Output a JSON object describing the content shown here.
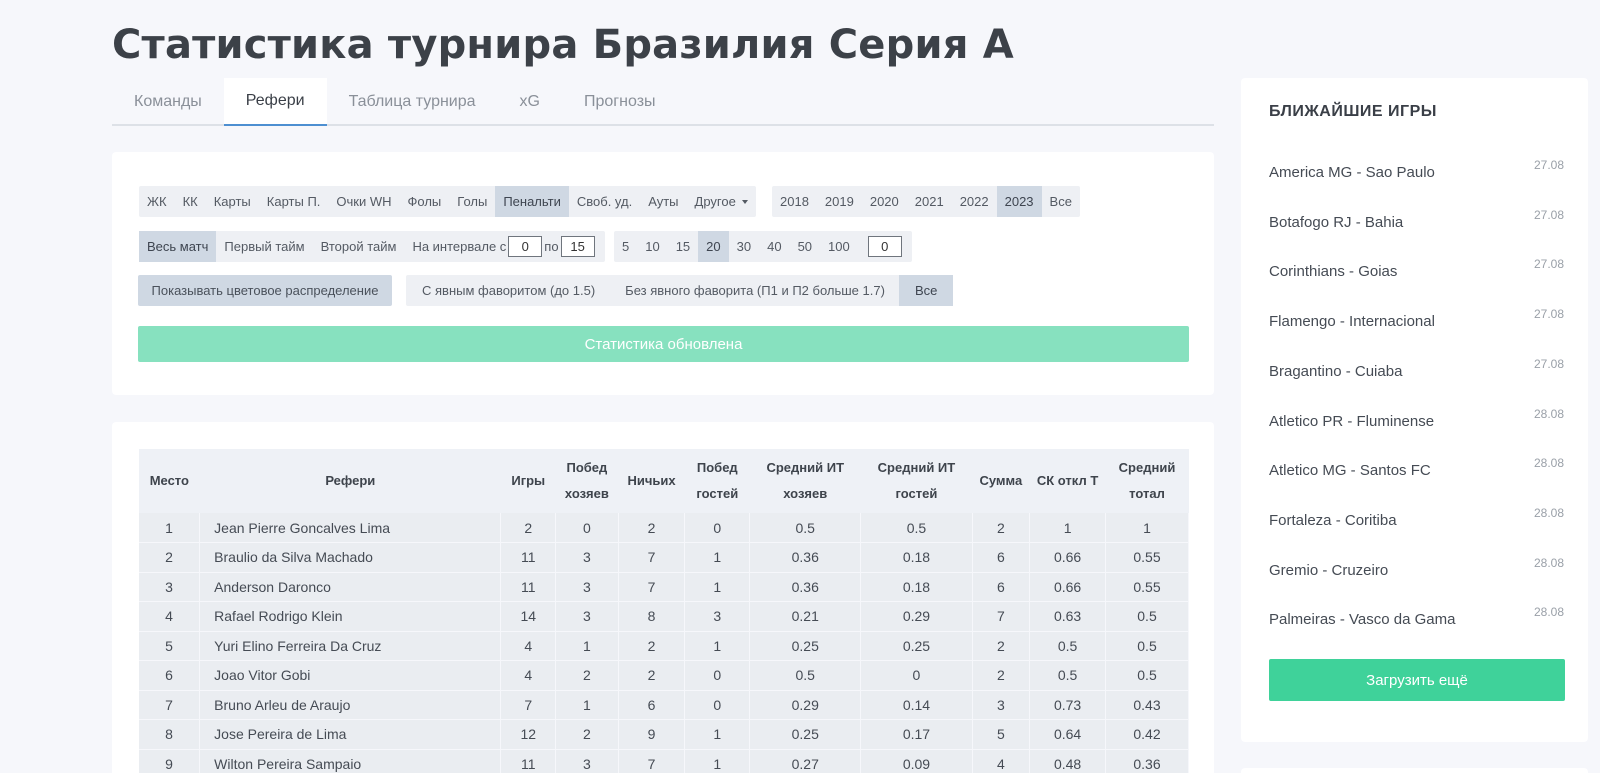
{
  "page": {
    "title": "Статистика турнира Бразилия Серия А"
  },
  "tabs": [
    "Команды",
    "Рефери",
    "Таблица турнира",
    "xG",
    "Прогнозы"
  ],
  "filters": {
    "stat_types": [
      "ЖК",
      "КК",
      "Карты",
      "Карты П.",
      "Очки WH",
      "Фолы",
      "Голы",
      "Пенальти",
      "Своб. уд.",
      "Ауты",
      "Другое"
    ],
    "years": [
      "2018",
      "2019",
      "2020",
      "2021",
      "2022",
      "2023",
      "Все"
    ],
    "periods": [
      "Весь матч",
      "Первый тайм",
      "Второй тайм"
    ],
    "interval": {
      "label_from": "На интервале с",
      "from": "0",
      "label_to": "по",
      "to": "15"
    },
    "counts": [
      "5",
      "10",
      "15",
      "20",
      "30",
      "40",
      "50",
      "100"
    ],
    "count_custom": "0",
    "color_dist": "Показывать цветовое распределение",
    "favorites": [
      "С явным фаворитом (до 1.5)",
      "Без явного фаворита (П1 и П2 больше 1.7)",
      "Все"
    ],
    "status": "Статистика обновлена"
  },
  "table": {
    "headers": [
      "Место",
      "Рефери",
      "Игры",
      "Побед хозяев",
      "Ничьих",
      "Побед гостей",
      "Средний ИТ хозяев",
      "Средний ИТ гостей",
      "Сумма",
      "СК откл Т",
      "Средний тотал"
    ],
    "rows": [
      [
        "1",
        "Jean Pierre Goncalves Lima",
        "2",
        "0",
        "2",
        "0",
        "0.5",
        "0.5",
        "2",
        "1",
        "1"
      ],
      [
        "2",
        "Braulio da Silva Machado",
        "11",
        "3",
        "7",
        "1",
        "0.36",
        "0.18",
        "6",
        "0.66",
        "0.55"
      ],
      [
        "3",
        "Anderson Daronco",
        "11",
        "3",
        "7",
        "1",
        "0.36",
        "0.18",
        "6",
        "0.66",
        "0.55"
      ],
      [
        "4",
        "Rafael Rodrigo Klein",
        "14",
        "3",
        "8",
        "3",
        "0.21",
        "0.29",
        "7",
        "0.63",
        "0.5"
      ],
      [
        "5",
        "Yuri Elino Ferreira Da Cruz",
        "4",
        "1",
        "2",
        "1",
        "0.25",
        "0.25",
        "2",
        "0.5",
        "0.5"
      ],
      [
        "6",
        "Joao Vitor Gobi",
        "4",
        "2",
        "2",
        "0",
        "0.5",
        "0",
        "2",
        "0.5",
        "0.5"
      ],
      [
        "7",
        "Bruno Arleu de Araujo",
        "7",
        "1",
        "6",
        "0",
        "0.29",
        "0.14",
        "3",
        "0.73",
        "0.43"
      ],
      [
        "8",
        "Jose Pereira de Lima",
        "12",
        "2",
        "9",
        "1",
        "0.25",
        "0.17",
        "5",
        "0.64",
        "0.42"
      ],
      [
        "9",
        "Wilton Pereira Sampaio",
        "11",
        "3",
        "7",
        "1",
        "0.27",
        "0.09",
        "4",
        "0.48",
        "0.36"
      ]
    ]
  },
  "sidebar": {
    "title": "БЛИЖАЙШИЕ ИГРЫ",
    "games": [
      {
        "teams": "America MG - Sao Paulo",
        "date": "27.08"
      },
      {
        "teams": "Botafogo RJ - Bahia",
        "date": "27.08"
      },
      {
        "teams": "Corinthians - Goias",
        "date": "27.08"
      },
      {
        "teams": "Flamengo - Internacional",
        "date": "27.08"
      },
      {
        "teams": "Bragantino - Cuiaba",
        "date": "27.08"
      },
      {
        "teams": "Atletico PR - Fluminense",
        "date": "28.08"
      },
      {
        "teams": "Atletico MG - Santos FC",
        "date": "28.08"
      },
      {
        "teams": "Fortaleza - Coritiba",
        "date": "28.08"
      },
      {
        "teams": "Gremio - Cruzeiro",
        "date": "28.08"
      },
      {
        "teams": "Palmeiras - Vasco da Gama",
        "date": "28.08"
      }
    ],
    "load_more": "Загрузить ещё"
  },
  "colors": {
    "accent": "#3fd29a",
    "status": "#87e1bf",
    "selected": "#cfd8e3",
    "tab_underline": "#4d8fd1"
  }
}
